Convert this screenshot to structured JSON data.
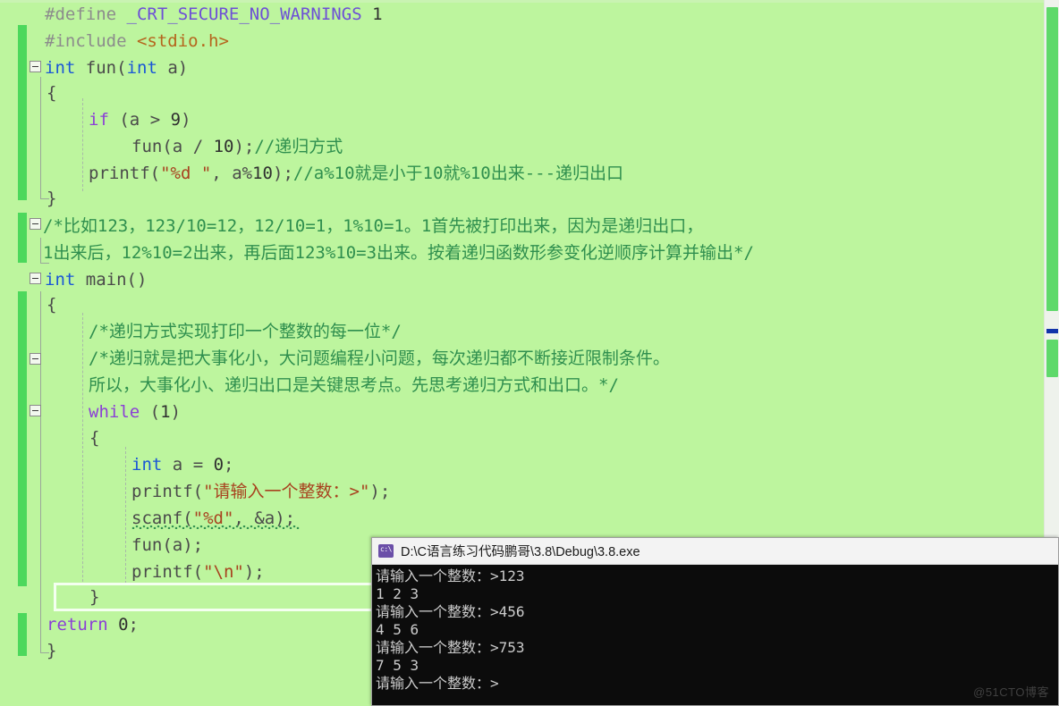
{
  "window": {
    "app": "Visual Studio C editor",
    "background_color": "#bdf59e"
  },
  "colors": {
    "editor_bg": "#bdf59e",
    "change_bar": "#4cd85c",
    "keyword_type": "#1a57d6",
    "keyword_control": "#8b3fd6",
    "macro": "#6d4fd6",
    "preprocessor": "#8c8c8c",
    "header": "#b5651d",
    "string": "#a8421f",
    "comment": "#2f8f4e",
    "console_bg": "#0c0c0c",
    "console_fg": "#cccccc",
    "scroll_thumb": "#5ed96a",
    "scroll_mark": "#1133aa"
  },
  "editor": {
    "fold_markers": [
      {
        "line": 2,
        "state": "expanded"
      },
      {
        "line": 7,
        "state": "expanded"
      },
      {
        "line": 9,
        "state": "expanded"
      },
      {
        "line": 13,
        "state": "expanded"
      },
      {
        "line": 15,
        "state": "expanded"
      }
    ],
    "code_lines": [
      {
        "n": 0,
        "indent": 0,
        "text": "#define _CRT_SECURE_NO_WARNINGS 1"
      },
      {
        "n": 1,
        "indent": 0,
        "text": "#include <stdio.h>"
      },
      {
        "n": 2,
        "indent": 0,
        "text": "int fun(int a)"
      },
      {
        "n": 3,
        "indent": 0,
        "text": "{"
      },
      {
        "n": 4,
        "indent": 1,
        "text": "if (a > 9)"
      },
      {
        "n": 5,
        "indent": 2,
        "text": "fun(a / 10);//递归方式"
      },
      {
        "n": 6,
        "indent": 1,
        "text": "printf(\"%d \", a%10);//a%10就是小于10就%10出来---递归出口"
      },
      {
        "n": 7,
        "indent": 0,
        "text": "}"
      },
      {
        "n": 8,
        "indent": 0,
        "text": "/*比如123，123/10=12，12/10=1，1%10=1。1首先被打印出来，因为是递归出口，"
      },
      {
        "n": 9,
        "indent": 0,
        "text": "1出来后，12%10=2出来，再后面123%10=3出来。按着递归函数形参变化逆顺序计算并输出*/"
      },
      {
        "n": 10,
        "indent": 0,
        "text": "int main()"
      },
      {
        "n": 11,
        "indent": 0,
        "text": "{"
      },
      {
        "n": 12,
        "indent": 1,
        "text": "/*递归方式实现打印一个整数的每一位*/"
      },
      {
        "n": 13,
        "indent": 1,
        "text": "/*递归就是把大事化小，大问题编程小问题，每次递归都不断接近限制条件。"
      },
      {
        "n": 14,
        "indent": 1,
        "text": "所以，大事化小、递归出口是关键思考点。先思考递归方式和出口。*/"
      },
      {
        "n": 15,
        "indent": 1,
        "text": "while (1)"
      },
      {
        "n": 16,
        "indent": 1,
        "text": "{"
      },
      {
        "n": 17,
        "indent": 2,
        "text": "int a = 0;"
      },
      {
        "n": 18,
        "indent": 2,
        "text": "printf(\"请输入一个整数：>\");"
      },
      {
        "n": 19,
        "indent": 2,
        "text": "scanf(\"%d\", &a);"
      },
      {
        "n": 20,
        "indent": 2,
        "text": "fun(a);"
      },
      {
        "n": 21,
        "indent": 2,
        "text": "printf(\"\\n\");"
      },
      {
        "n": 22,
        "indent": 1,
        "text": "}"
      },
      {
        "n": 23,
        "indent": 0,
        "text": "return 0;"
      },
      {
        "n": 24,
        "indent": 0,
        "text": "}"
      }
    ],
    "tokens": {
      "define": "#define",
      "include": "#include",
      "macro_name": "_CRT_SECURE_NO_WARNINGS",
      "macro_value": "1",
      "header_name": "<stdio.h>",
      "type_int": "int",
      "fn_fun": "fun",
      "fn_main": "main",
      "kw_if": "if",
      "kw_while": "while",
      "kw_return": "return",
      "fn_printf": "printf",
      "fn_scanf": "scanf",
      "var_a": "a",
      "str_pct_d_space": "\"%d \"",
      "str_pct_d": "\"%d\"",
      "str_prompt": "\"请输入一个整数：>\"",
      "str_newline": "\"\\n\"",
      "cmt_recursive_way": "//递归方式",
      "cmt_mod10": "//a%10就是小于10就%10出来---递归出口",
      "cmt_block_1": "/*比如123，123/10=12，12/10=1，1%10=1。1首先被打印出来，因为是递归出口，",
      "cmt_block_1b": "1出来后，12%10=2出来，再后面123%10=3出来。按着递归函数形参变化逆顺序计算并输出*/",
      "cmt_block_2": "/*递归方式实现打印一个整数的每一位*/",
      "cmt_block_3": "/*递归就是把大事化小，大问题编程小问题，每次递归都不断接近限制条件。",
      "cmt_block_3b": "所以，大事化小、递归出口是关键思考点。先思考递归方式和出口。*/"
    },
    "squiggle_note": "green wavy error/warning underline under scanf(\"%d\", &a)"
  },
  "scrollbar": {
    "name": "vertical-scrollbar",
    "thumb_top_pct": 1,
    "thumb_height_pct": 43,
    "marker_label": "caret-position-marker"
  },
  "console": {
    "title": "D:\\C语言练习代码鹏哥\\3.8\\Debug\\3.8.exe",
    "icon": "cmd-prompt-icon",
    "lines": [
      "请输入一个整数：>123",
      "1 2 3",
      "请输入一个整数：>456",
      "4 5 6",
      "请输入一个整数：>753",
      "7 5 3",
      "请输入一个整数：>"
    ]
  },
  "watermark": {
    "text": "@51CTO博客"
  }
}
